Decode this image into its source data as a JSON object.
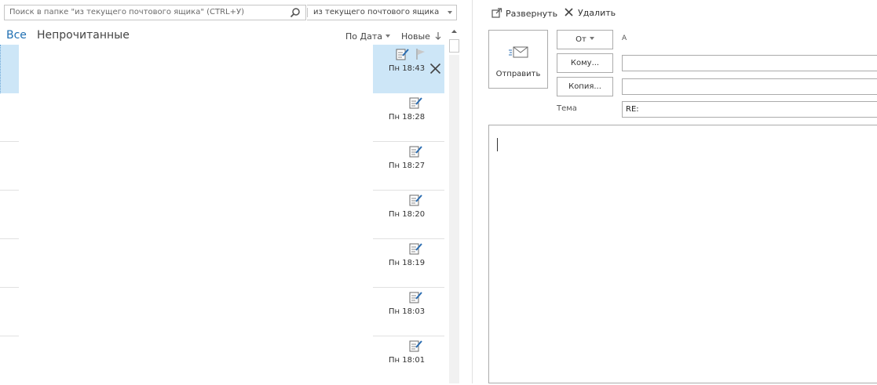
{
  "search": {
    "placeholder": "Поиск в папке \"из текущего почтового ящика\" (CTRL+У)",
    "scope": "из текущего почтового ящика"
  },
  "filters": {
    "all": "Все",
    "unread": "Непрочитанные",
    "sort_by": "По Дата",
    "order": "Новые"
  },
  "messages": [
    {
      "time": "Пн 18:43"
    },
    {
      "time": "Пн 18:28"
    },
    {
      "time": "Пн 18:27"
    },
    {
      "time": "Пн 18:20"
    },
    {
      "time": "Пн 18:19"
    },
    {
      "time": "Пн 18:03"
    },
    {
      "time": "Пн 18:01"
    }
  ],
  "toolbar": {
    "expand": "Развернуть",
    "delete": "Удалить"
  },
  "compose": {
    "send": "Отправить",
    "from": "От",
    "from_value": "А",
    "to": "Кому...",
    "to_value": "",
    "cc": "Копия...",
    "subject_label": "Тема",
    "subject_value": "RE:"
  },
  "colors": {
    "accent": "#1f6fb2",
    "selection": "#cde6f7"
  }
}
